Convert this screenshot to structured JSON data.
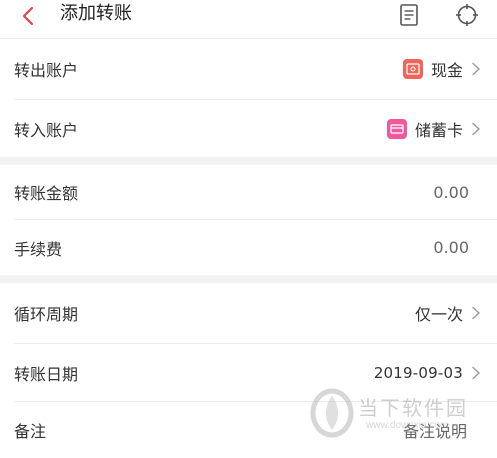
{
  "header": {
    "title": "添加转账",
    "back_icon": "chevron-left-icon",
    "doc_icon": "document-icon",
    "target_icon": "crosshair-icon",
    "accent_color": "#e8404c"
  },
  "rows": {
    "from_account": {
      "label": "转出账户",
      "value": "现金",
      "icon": "cash-icon",
      "icon_color": "#f26358"
    },
    "to_account": {
      "label": "转入账户",
      "value": "储蓄卡",
      "icon": "debit-card-icon",
      "icon_color": "#f05a9c"
    },
    "amount": {
      "label": "转账金额",
      "value": "0.00"
    },
    "fee": {
      "label": "手续费",
      "value": "0.00"
    },
    "cycle": {
      "label": "循环周期",
      "value": "仅一次"
    },
    "date": {
      "label": "转账日期",
      "value": "2019-09-03"
    },
    "note": {
      "label": "备注",
      "value": "备注说明"
    }
  },
  "watermark": {
    "text": "当下软件园",
    "url": "www.downxia.com"
  }
}
